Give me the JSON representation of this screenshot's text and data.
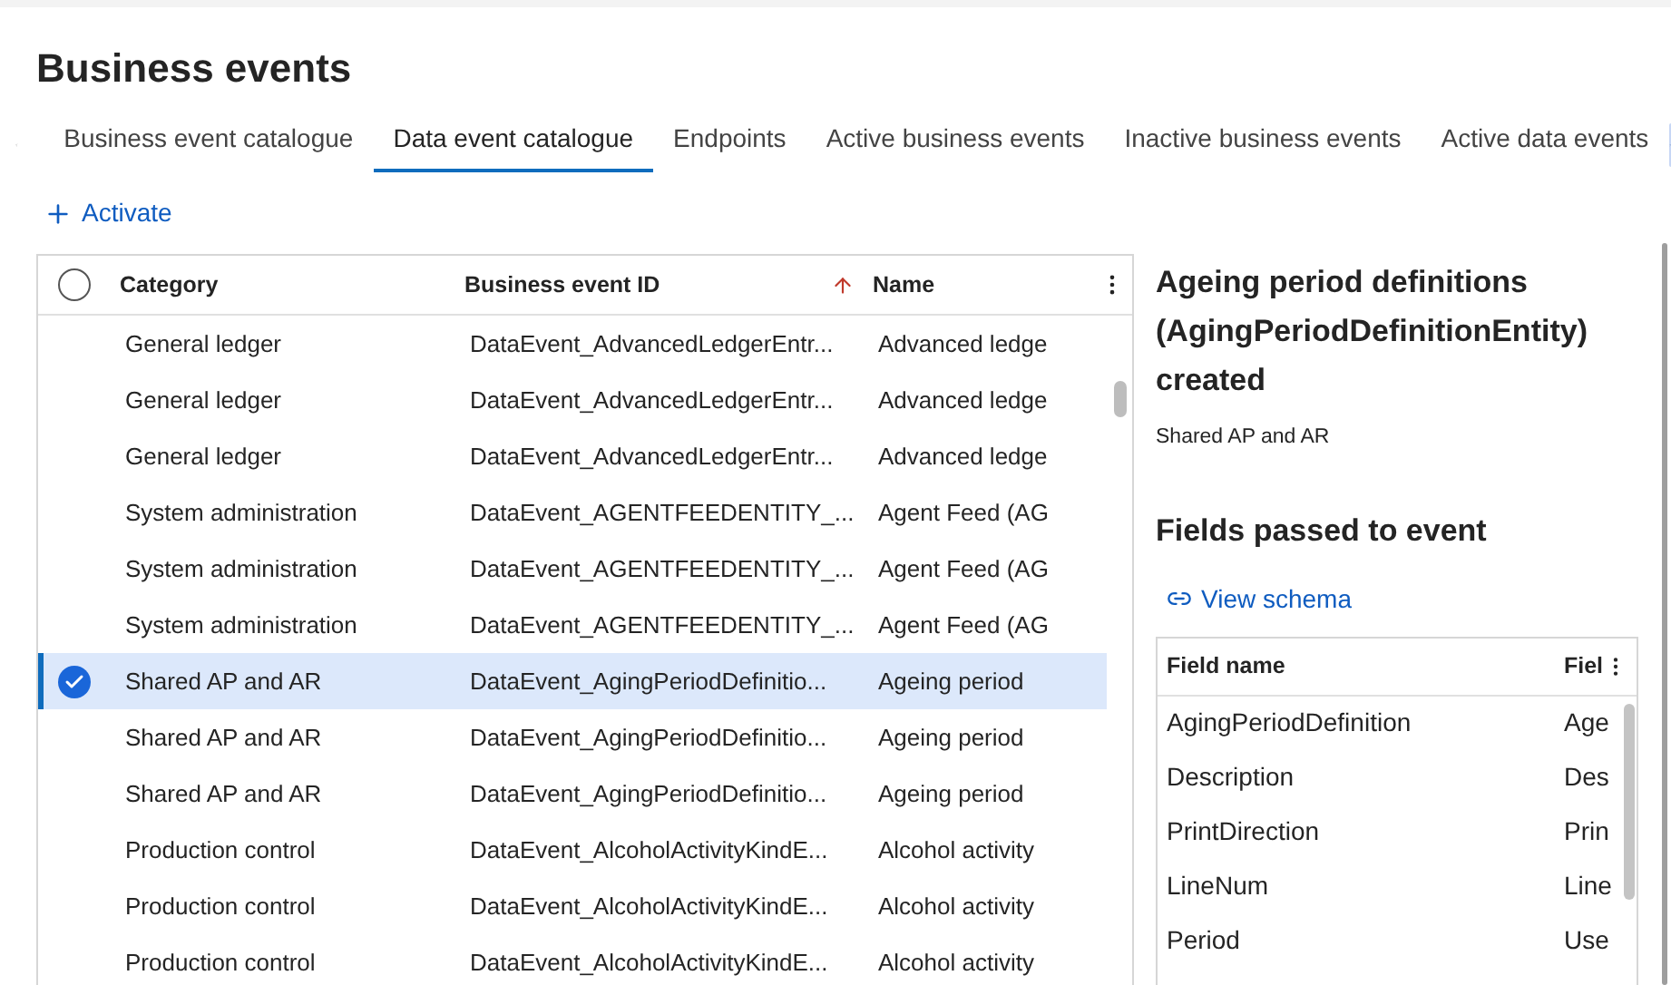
{
  "page_title": "Business events",
  "tabs": [
    {
      "label": "Business event catalogue",
      "selected": false
    },
    {
      "label": "Data event catalogue",
      "selected": true
    },
    {
      "label": "Endpoints",
      "selected": false
    },
    {
      "label": "Active business events",
      "selected": false
    },
    {
      "label": "Inactive business events",
      "selected": false
    },
    {
      "label": "Active data events",
      "selected": false
    }
  ],
  "activate_button": "Activate",
  "grid": {
    "columns": [
      "Category",
      "Business event ID",
      "Name"
    ],
    "rows": [
      {
        "category": "General ledger",
        "id": "DataEvent_AdvancedLedgerEntr...",
        "name": "Advanced ledge",
        "selected": false
      },
      {
        "category": "General ledger",
        "id": "DataEvent_AdvancedLedgerEntr...",
        "name": "Advanced ledge",
        "selected": false
      },
      {
        "category": "General ledger",
        "id": "DataEvent_AdvancedLedgerEntr...",
        "name": "Advanced ledge",
        "selected": false
      },
      {
        "category": "System administration",
        "id": "DataEvent_AGENTFEEDENTITY_...",
        "name": "Agent Feed (AG",
        "selected": false
      },
      {
        "category": "System administration",
        "id": "DataEvent_AGENTFEEDENTITY_...",
        "name": "Agent Feed (AG",
        "selected": false
      },
      {
        "category": "System administration",
        "id": "DataEvent_AGENTFEEDENTITY_...",
        "name": "Agent Feed (AG",
        "selected": false
      },
      {
        "category": "Shared AP and AR",
        "id": "DataEvent_AgingPeriodDefinitio...",
        "name": "Ageing period",
        "selected": true
      },
      {
        "category": "Shared AP and AR",
        "id": "DataEvent_AgingPeriodDefinitio...",
        "name": "Ageing period",
        "selected": false
      },
      {
        "category": "Shared AP and AR",
        "id": "DataEvent_AgingPeriodDefinitio...",
        "name": "Ageing period",
        "selected": false
      },
      {
        "category": "Production control",
        "id": "DataEvent_AlcoholActivityKindE...",
        "name": "Alcohol activity",
        "selected": false
      },
      {
        "category": "Production control",
        "id": "DataEvent_AlcoholActivityKindE...",
        "name": "Alcohol activity",
        "selected": false
      },
      {
        "category": "Production control",
        "id": "DataEvent_AlcoholActivityKindE...",
        "name": "Alcohol activity",
        "selected": false
      }
    ]
  },
  "detail": {
    "title": "Ageing period definitions (AgingPeriodDefinitionEntity) created",
    "category": "Shared AP and AR",
    "fields_heading": "Fields passed to event",
    "view_schema": "View schema",
    "fields_columns": [
      "Field name",
      "Fiel"
    ],
    "fields": [
      {
        "name": "AgingPeriodDefinition",
        "column_2": "Age"
      },
      {
        "name": "Description",
        "column_2": "Des"
      },
      {
        "name": "PrintDirection",
        "column_2": "Prin"
      },
      {
        "name": "LineNum",
        "column_2": "Line"
      },
      {
        "name": "Period",
        "column_2": "Use"
      }
    ]
  }
}
